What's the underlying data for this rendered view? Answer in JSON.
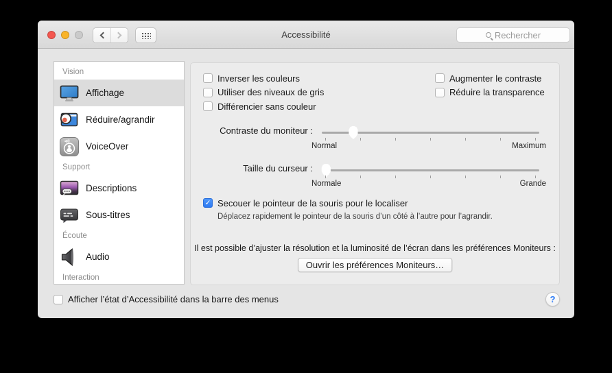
{
  "window": {
    "title": "Accessibilité"
  },
  "toolbar": {
    "search_placeholder": "Rechercher"
  },
  "sidebar": {
    "sections": [
      {
        "label": "Vision",
        "items": [
          {
            "label": "Affichage",
            "icon": "display-icon",
            "selected": true
          },
          {
            "label": "Réduire/agrandir",
            "icon": "zoom-icon",
            "selected": false
          },
          {
            "label": "VoiceOver",
            "icon": "voiceover-icon",
            "selected": false
          }
        ]
      },
      {
        "label": "Support",
        "items": [
          {
            "label": "Descriptions",
            "icon": "descriptions-icon",
            "selected": false
          },
          {
            "label": "Sous-titres",
            "icon": "subtitles-icon",
            "selected": false
          }
        ]
      },
      {
        "label": "Écoute",
        "items": [
          {
            "label": "Audio",
            "icon": "audio-icon",
            "selected": false
          }
        ]
      },
      {
        "label": "Interaction",
        "items": []
      }
    ]
  },
  "main": {
    "checkboxes_left": [
      {
        "label": "Inverser les couleurs",
        "checked": false
      },
      {
        "label": "Utiliser des niveaux de gris",
        "checked": false
      },
      {
        "label": "Différencier sans couleur",
        "checked": false
      }
    ],
    "checkboxes_right": [
      {
        "label": "Augmenter le contraste",
        "checked": false
      },
      {
        "label": "Réduire la transparence",
        "checked": false
      }
    ],
    "contrast_slider": {
      "label": "Contraste du moniteur :",
      "min_label": "Normal",
      "max_label": "Maximum",
      "value_pct": 14.5
    },
    "cursor_slider": {
      "label": "Taille du curseur :",
      "min_label": "Normale",
      "max_label": "Grande",
      "value_pct": 2
    },
    "shake_checkbox": {
      "label": "Secouer le pointeur de la souris pour le localiser",
      "checked": true,
      "description": "Déplacez rapidement le pointeur de la souris d’un côté à l’autre pour l’agrandir."
    },
    "monitors_note": "Il est possible d’ajuster la résolution et la luminosité de l’écran dans les préférences Moniteurs :",
    "monitors_button": "Ouvrir les préférences Moniteurs…"
  },
  "footer": {
    "menubar_checkbox": {
      "label": "Afficher l’état d’Accessibilité dans la barre des menus",
      "checked": false
    },
    "help_label": "?"
  },
  "colors": {
    "accent": "#3b87f7",
    "help_blue": "#2d7cf7",
    "selection": "#dcdcdc"
  }
}
